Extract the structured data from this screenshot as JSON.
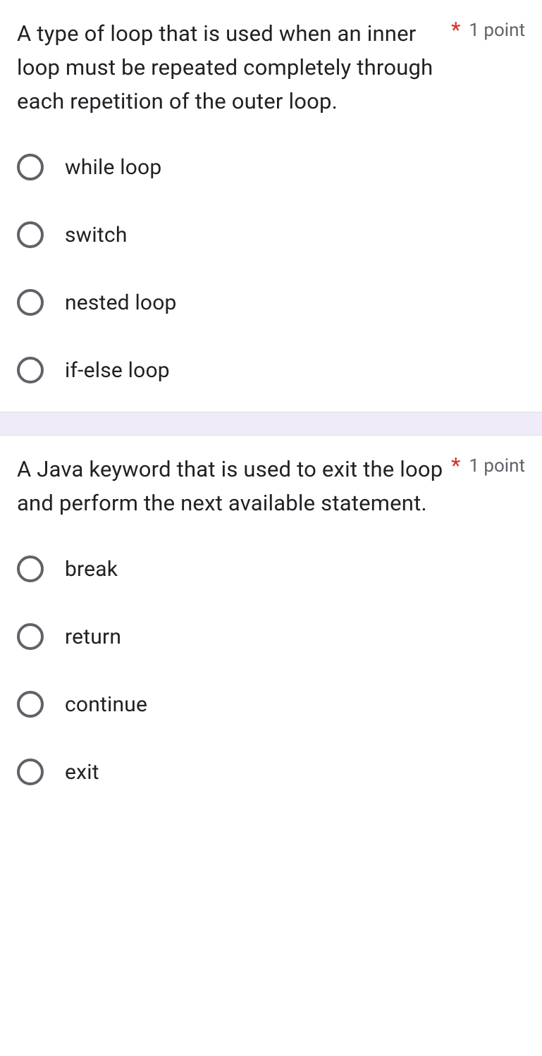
{
  "questions": [
    {
      "text": "A type of loop that is used when an inner loop must be repeated completely through each repetition of the outer loop.",
      "required_mark": "*",
      "points": "1 point",
      "options": [
        "while loop",
        "switch",
        "nested loop",
        "if-else loop"
      ]
    },
    {
      "text": "A Java keyword that is used to exit the loop and perform the next available statement.",
      "required_mark": "*",
      "points": "1 point",
      "options": [
        "break",
        "return",
        "continue",
        "exit"
      ]
    }
  ]
}
